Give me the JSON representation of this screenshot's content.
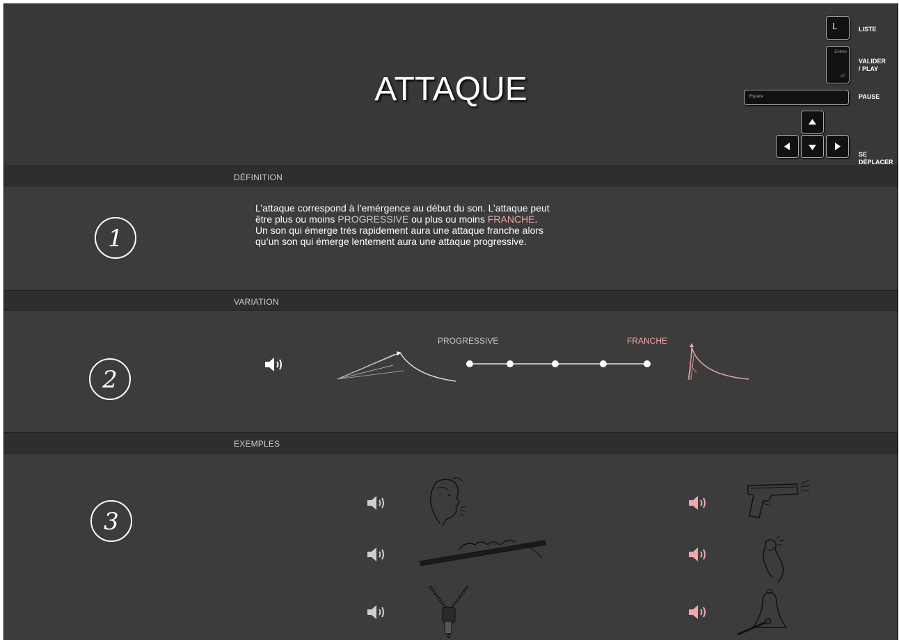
{
  "header": {
    "title": "ATTAQUE",
    "keys": {
      "list_key": "L",
      "list_label": "LISTE",
      "enter_key": "Entrée",
      "enter_label_1": "VALIDER",
      "enter_label_2": "/ PLAY",
      "space_key": "Espace",
      "space_label": "PAUSE",
      "move_label": "SE DÉPLACER"
    }
  },
  "definition": {
    "heading": "DÉFINITION",
    "number": "1",
    "line1": "L’attaque correspond à l’emérgence au début du son. L’attaque peut",
    "line2_a": "être plus ou moins ",
    "line2_prog": "PROGRESSIVE",
    "line2_b": " ou plus ou moins ",
    "line2_franche": "FRANCHE",
    "line2_c": ".",
    "line3": "Un son qui émerge très rapidement aura une attaque franche alors",
    "line4": "qu’un son qui émerge lentement aura une attaque progressive."
  },
  "variation": {
    "heading": "VARIATION",
    "number": "2",
    "left_label": "PROGRESSIVE",
    "right_label": "FRANCHE",
    "slider_steps": 5,
    "selected_step": null
  },
  "examples": {
    "heading": "EXEMPLES",
    "number": "3",
    "progressive_items": [
      "blowing-face",
      "flute",
      "zipper"
    ],
    "franche_items": [
      "pistol",
      "finger-snap",
      "bell"
    ]
  },
  "colors": {
    "progressive": "#c8c8c8",
    "franche": "#f0a8a8",
    "background": "#3c3c3c",
    "band": "#2e2e2e"
  }
}
